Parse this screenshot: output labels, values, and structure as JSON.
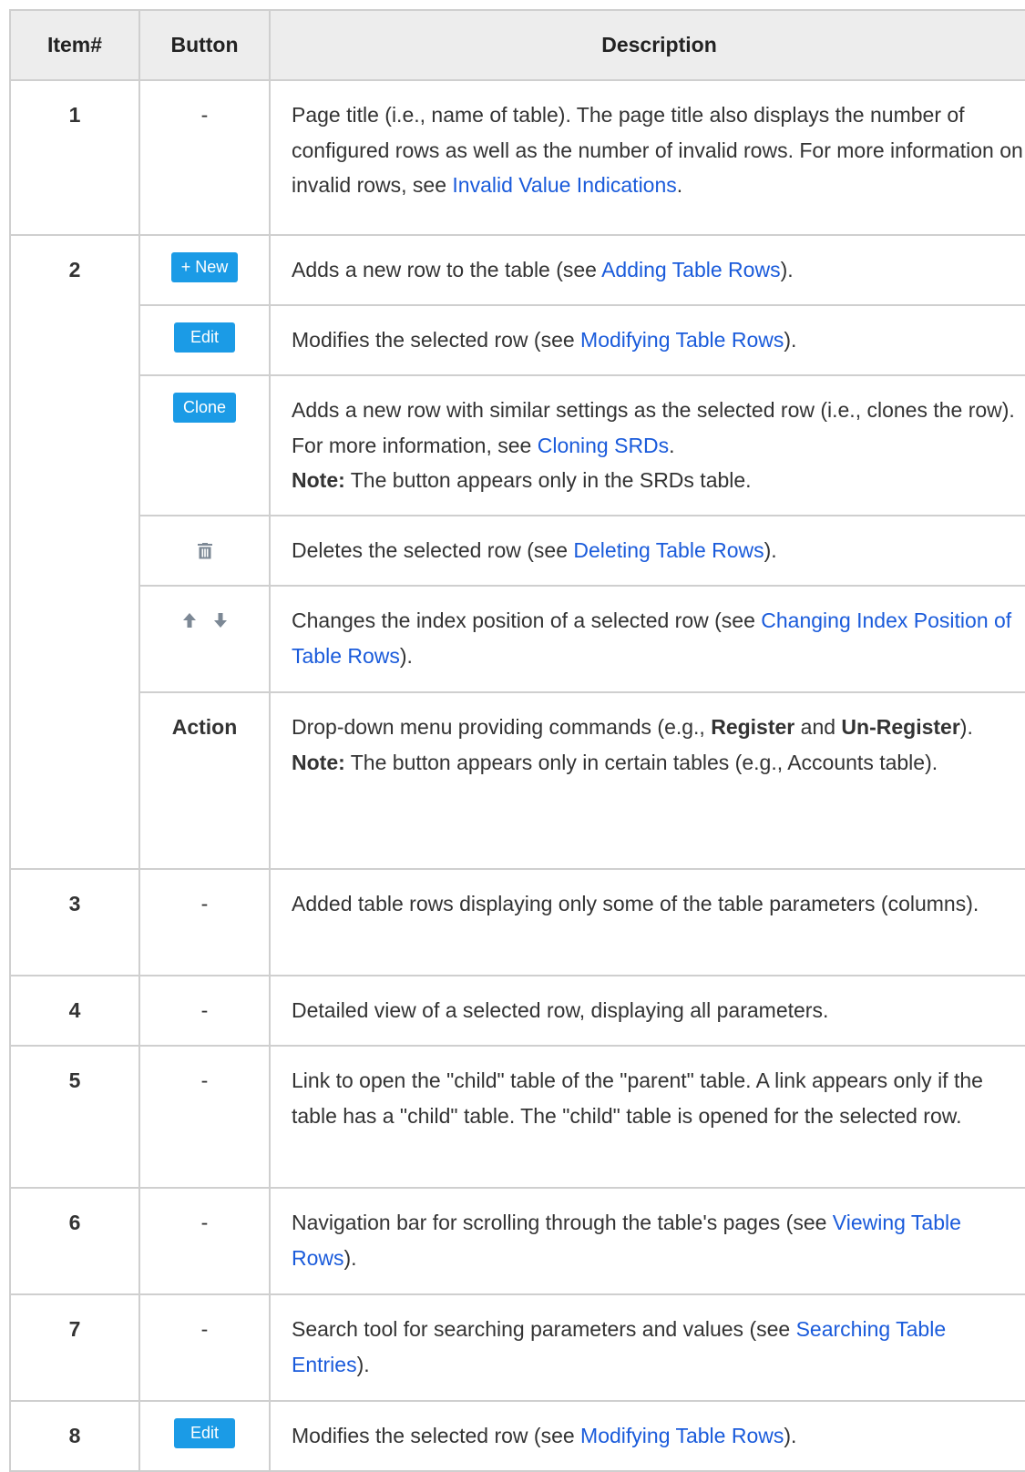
{
  "headers": {
    "item": "Item#",
    "button": "Button",
    "description": "Description"
  },
  "rows": {
    "r1": {
      "item": "1",
      "button": "-",
      "desc_a": "Page title (i.e., name of table). The page title also displays the number of configured rows as well as the number of invalid rows. For more information on invalid rows, see ",
      "link": "Invalid Value Indications",
      "desc_b": "."
    },
    "r2new": {
      "item": "2",
      "button": "+ New",
      "desc_a": "Adds a new row to the table (see ",
      "link": "Adding Table Rows",
      "desc_b": ")."
    },
    "r2edit": {
      "button": "Edit",
      "desc_a": "Modifies the selected row (see ",
      "link": "Modifying Table Rows",
      "desc_b": ")."
    },
    "r2clone": {
      "button": "Clone",
      "desc_a": "Adds a new row with similar settings as the selected row (i.e., clones the row). For more information, see ",
      "link": "Cloning SRDs",
      "desc_b": ".",
      "note_label": "Note:",
      "note_text": " The button appears only in the SRDs table."
    },
    "r2delete": {
      "icon": "trash-icon",
      "desc_a": "Deletes the selected row (see ",
      "link": "Deleting Table Rows",
      "desc_b": ")."
    },
    "r2arrows": {
      "icons": [
        "arrow-up-icon",
        "arrow-down-icon"
      ],
      "desc_a": "Changes the index position of a selected row (see ",
      "link": "Changing Index Position of Table Rows",
      "desc_b": ")."
    },
    "r2action": {
      "button": "Action",
      "desc_a": "Drop-down menu providing commands (e.g., ",
      "bold1": "Register",
      "mid": " and ",
      "bold2": "Un-Register",
      "desc_b": ").",
      "note_label": "Note:",
      "note_text": " The button appears only in certain tables (e.g., Accounts table)."
    },
    "r3": {
      "item": "3",
      "button": "-",
      "desc": "Added table rows displaying only some of the table parameters (columns)."
    },
    "r4": {
      "item": "4",
      "button": "-",
      "desc": "Detailed view of a selected row, displaying all parameters."
    },
    "r5": {
      "item": "5",
      "button": "-",
      "desc": "Link to open the \"child\" table of the \"parent\" table. A link appears only if the table has a \"child\" table. The \"child\" table is opened for the selected row."
    },
    "r6": {
      "item": "6",
      "button": "-",
      "desc_a": "Navigation bar for scrolling through the table's pages (see ",
      "link": "Viewing Table Rows",
      "desc_b": ")."
    },
    "r7": {
      "item": "7",
      "button": "-",
      "desc_a": "Search tool for searching parameters and values (see ",
      "link": "Searching Table Entries",
      "desc_b": ")."
    },
    "r8": {
      "item": "8",
      "button": "Edit",
      "desc_a": "Modifies the selected row (see ",
      "link": "Modifying Table Rows",
      "desc_b": ")."
    }
  },
  "colors": {
    "button_bg": "#1b9be6",
    "link": "#1a5bdb",
    "header_bg": "#ededed",
    "border": "#cfcfcf"
  }
}
